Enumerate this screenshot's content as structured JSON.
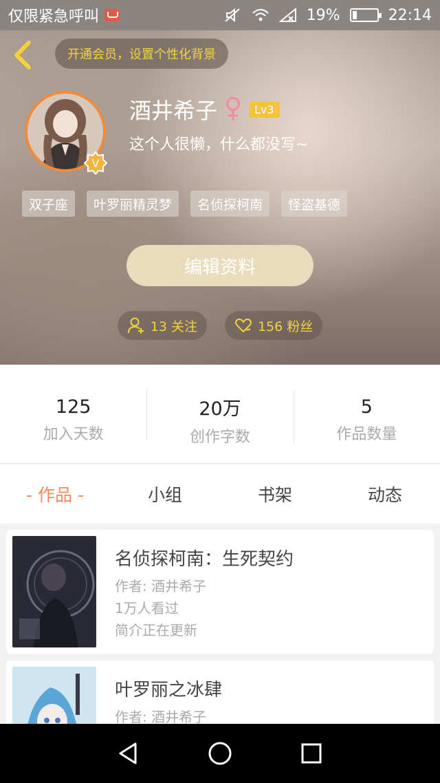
{
  "status_bar": {
    "carrier": "仅限紧急呼叫",
    "battery": "19%",
    "time": "22:14",
    "icons": [
      "mail-icon",
      "mute-icon",
      "wifi-icon",
      "signal-icon",
      "battery-icon"
    ]
  },
  "header": {
    "vip_prompt": "开通会员，设置个性化背景",
    "username": "酒井希子",
    "gender_symbol": "♀",
    "level": "Lv3",
    "bio": "这个人很懒，什么都没写~",
    "avatar_badge": "V",
    "tags": [
      "双子座",
      "叶罗丽精灵梦",
      "名侦探柯南",
      "怪盗基德"
    ],
    "edit_button": "编辑资料",
    "follow_label": "13 关注",
    "fans_label": "156 粉丝"
  },
  "stats": [
    {
      "value": "125",
      "label": "加入天数"
    },
    {
      "value": "20万",
      "label": "创作字数"
    },
    {
      "value": "5",
      "label": "作品数量"
    }
  ],
  "tabs": [
    {
      "label": "- 作品 -",
      "active": true
    },
    {
      "label": "小组",
      "active": false
    },
    {
      "label": "书架",
      "active": false
    },
    {
      "label": "动态",
      "active": false
    }
  ],
  "works": [
    {
      "title": "名侦探柯南：生死契约",
      "author": "作者: 酒井希子",
      "views": "1万人看过",
      "intro": "简介正在更新"
    },
    {
      "title": "叶罗丽之冰肆",
      "author": "作者: 酒井希子"
    }
  ],
  "colors": {
    "accent_orange": "#f08a5a",
    "vip_yellow": "#f3d33c",
    "level_badge": "#f3c33c",
    "female_pink": "#f08aa0"
  }
}
